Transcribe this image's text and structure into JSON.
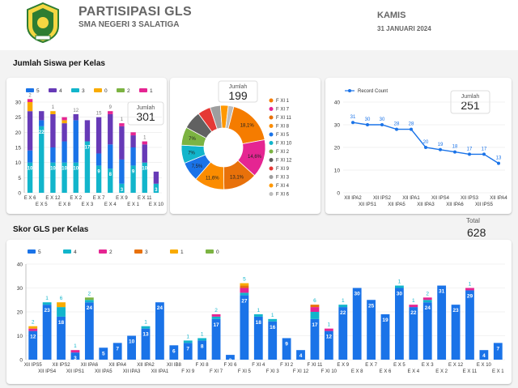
{
  "header": {
    "title": "PARTISIPASI GLS",
    "subtitle": "SMA NEGERI 3 SALATIGA",
    "day": "KAMIS",
    "date": "31 JANUARI 2024"
  },
  "colors": {
    "s5": "#1a73e8",
    "s4": "#12b5cb",
    "s3": "#e8710a",
    "s2": "#e52592",
    "s1": "#f9ab00",
    "s0": "#7cb342",
    "pie_orange": "#f57c00"
  },
  "sections": {
    "jumlah_siswa": "Jumlah Siswa per Kelas",
    "skor_gls": "Skor GLS per Kelas"
  },
  "scorecards": {
    "total_label": "Total",
    "total_value": "628"
  },
  "chart_data": [
    {
      "type": "bar",
      "stacked": true,
      "legend": [
        "5",
        "4",
        "3",
        "0",
        "2",
        "1"
      ],
      "categories": [
        "E X 6",
        "E X 5",
        "E X 12",
        "E X 8",
        "E X 2",
        "E X 3",
        "E X 7",
        "E X 4",
        "E X 9",
        "E X 1",
        "E X 11",
        "E X 10"
      ],
      "x_tick_labels": [
        "E X 6",
        "E X 5",
        "E X 12",
        "E X 8",
        "E X 2",
        "E X 3",
        "E X 7",
        "E X 4",
        "E X 9",
        "E X 1",
        "E X 11",
        "E X 10"
      ],
      "series": [
        {
          "name": "4",
          "color": "#12b5cb",
          "values": [
            10,
            22,
            10,
            10,
            10,
            17,
            9,
            8,
            3,
            9,
            10,
            3
          ]
        },
        {
          "name": "3",
          "color": "#1a73e8",
          "values": [
            4,
            2,
            5,
            7,
            14,
            0,
            4,
            8,
            8,
            6,
            0,
            0
          ]
        },
        {
          "name": "5",
          "color": "#673ab7",
          "values": [
            13,
            3,
            11,
            6,
            2,
            7,
            12,
            10,
            11,
            4,
            6,
            4
          ]
        },
        {
          "name": "0",
          "color": "#f9ab00",
          "values": [
            3,
            0,
            1,
            1,
            0,
            0,
            0,
            0,
            0,
            0,
            0,
            0
          ]
        },
        {
          "name": "2",
          "color": "#e52592",
          "values": [
            1,
            0,
            0,
            1,
            0,
            0,
            0,
            1,
            1,
            1,
            1,
            0
          ]
        },
        {
          "name": "1",
          "color": "#7cb342",
          "values": [
            0,
            0,
            0,
            0,
            0,
            0,
            0,
            0,
            0,
            0,
            0,
            0
          ]
        }
      ],
      "data_labels": [
        {
          "category": "E X 6",
          "series": "4",
          "text": "10"
        },
        {
          "category": "E X 6",
          "series": "3",
          "text": "4"
        },
        {
          "category": "E X 6",
          "series": "5",
          "text": "13"
        },
        {
          "category": "E X 6",
          "series": "0",
          "text": "3"
        },
        {
          "category": "E X 6",
          "series": "2",
          "text": "1"
        },
        {
          "category": "E X 6",
          "series": "top",
          "text": "2"
        },
        {
          "category": "E X 5",
          "series": "4",
          "text": "22"
        },
        {
          "category": "E X 12",
          "series": "4",
          "text": "10"
        },
        {
          "category": "E X 12",
          "series": "5",
          "text": "11"
        },
        {
          "category": "E X 12",
          "series": "top",
          "text": "1"
        },
        {
          "category": "E X 8",
          "series": "4",
          "text": "10"
        },
        {
          "category": "E X 2",
          "series": "4",
          "text": "10"
        },
        {
          "category": "E X 2",
          "series": "3",
          "text": "14"
        },
        {
          "category": "E X 2",
          "series": "top",
          "text": "12"
        },
        {
          "category": "E X 3",
          "series": "4",
          "text": "17"
        },
        {
          "category": "E X 7",
          "series": "4",
          "text": "9"
        },
        {
          "category": "E X 7",
          "series": "top",
          "text": "15"
        },
        {
          "category": "E X 4",
          "series": "4",
          "text": "8"
        },
        {
          "category": "E X 4",
          "series": "top",
          "text": "9"
        },
        {
          "category": "E X 9",
          "series": "4",
          "text": "3"
        },
        {
          "category": "E X 9",
          "series": "top",
          "text": "1"
        },
        {
          "category": "E X 1",
          "series": "4",
          "text": "9"
        },
        {
          "category": "E X 11",
          "series": "4",
          "text": "10"
        },
        {
          "category": "E X 11",
          "series": "top",
          "text": "1"
        },
        {
          "category": "E X 10",
          "series": "4",
          "text": "3"
        }
      ],
      "ylim": [
        0,
        30
      ],
      "yticks": [
        0,
        5,
        10,
        15,
        20,
        25,
        30
      ],
      "grid": true,
      "legend_position": "top",
      "scorecard": {
        "label": "Jumlah",
        "value": "301"
      }
    },
    {
      "type": "pie",
      "donut": true,
      "scorecard": {
        "label": "Jumlah",
        "value": "199"
      },
      "legend_position": "right",
      "slices": [
        {
          "label": "F XI 1",
          "value": 18.1,
          "color": "#f57c00",
          "text": "18,1%"
        },
        {
          "label": "F XI 7",
          "value": 14.6,
          "color": "#e52592",
          "text": "14,6%"
        },
        {
          "label": "F XI 11",
          "value": 13.1,
          "color": "#e8710a",
          "text": "13,1%"
        },
        {
          "label": "F XI 8",
          "value": 11.6,
          "color": "#fb8c00",
          "text": "11,6%"
        },
        {
          "label": "F XI 5",
          "value": 7.5,
          "color": "#1a73e8",
          "text": "7,5%"
        },
        {
          "label": "F XI 10",
          "value": 7,
          "color": "#12b5cb",
          "text": "7%"
        },
        {
          "label": "F XI 2",
          "value": 7,
          "color": "#7cb342",
          "text": "7%"
        },
        {
          "label": "F XI 12",
          "value": 7,
          "color": "#616161",
          "text": ""
        },
        {
          "label": "F XI 9",
          "value": 5,
          "color": "#e53935",
          "text": ""
        },
        {
          "label": "F XI 3",
          "value": 4,
          "color": "#9e9e9e",
          "text": ""
        },
        {
          "label": "F XI 4",
          "value": 3,
          "color": "#ff9800",
          "text": ""
        },
        {
          "label": "F XI 6",
          "value": 2.1,
          "color": "#bdbdbd",
          "text": ""
        }
      ],
      "legend": [
        "F XI 1",
        "F XI 7",
        "F XI 11",
        "F XI 8",
        "F XI 5",
        "F XI 10",
        "F XI 2",
        "F XI 12",
        "F XI 9",
        "F XI 3",
        "F XI 4",
        "F XI 6"
      ]
    },
    {
      "type": "line",
      "legend": [
        "Record Count"
      ],
      "legend_position": "top",
      "scorecard": {
        "label": "Jumlah",
        "value": "251"
      },
      "categories": [
        "XII IPA2",
        "XII IPS1",
        "XII IPS2",
        "XII IPA5",
        "XII IPA1",
        "XII IPA3",
        "XII IPS4",
        "XII IPA6",
        "XII IPS3",
        "XII IPS5",
        "XII IPA4"
      ],
      "x_tick_labels": [
        "XII IPA2",
        "XII IPS1",
        "XII IPS2",
        "XII IPA5",
        "XII IPA1",
        "XII IPA3",
        "XII IPS4",
        "XII IPA6",
        "XII IPS3",
        "XII IPS5",
        "XII IPA4"
      ],
      "values": [
        31,
        30,
        30,
        28,
        28,
        20,
        19,
        18,
        17,
        17,
        13
      ],
      "ylim": [
        0,
        40
      ],
      "yticks": [
        0,
        10,
        20,
        30,
        40
      ],
      "grid": true
    },
    {
      "type": "bar",
      "stacked": true,
      "legend": [
        "5",
        "4",
        "2",
        "3",
        "1",
        "0"
      ],
      "legend_position": "top",
      "categories": [
        "XII IPS5",
        "XII IPS4",
        "XII IPS2",
        "XII IPS1",
        "XII IPA6",
        "XII IPA5",
        "XII IPA4",
        "XII IPA3",
        "XII IPA2",
        "XII IPA1",
        "XII IB8",
        "F XI 9",
        "F XI 8",
        "F XI 7",
        "F XI 6",
        "F XI 5",
        "F XI 4",
        "F XI 3",
        "F XI 2",
        "F XI 12",
        "F XI 11",
        "F XI 10",
        "E X 9",
        "E X 8",
        "E X 7",
        "E X 6",
        "E X 5",
        "E X 4",
        "E X 3",
        "E X 2",
        "E X 12",
        "E X 11",
        "E X 10",
        "E X 1"
      ],
      "x_tick_labels": [
        "XII IPS5",
        "XII IPS4",
        "XII IPS2",
        "XII IPS1",
        "XII IPA6",
        "XII IPA5",
        "XII IPA4",
        "XII IPA3",
        "XII IPA2",
        "XII IPA1",
        "XII IB8",
        "F XI 9",
        "F XI 8",
        "F XI 7",
        "F XI 6",
        "F XI 5",
        "F XI 4",
        "F XI 3",
        "F XI 2",
        "F XI 12",
        "F XI 11",
        "F XI 10",
        "E X 9",
        "E X 8",
        "E X 7",
        "E X 6",
        "E X 5",
        "E X 4",
        "E X 3",
        "E X 2",
        "E X 12",
        "E X 11",
        "E X 10",
        "E X 1"
      ],
      "series": [
        {
          "name": "5",
          "color": "#1a73e8",
          "values": [
            12,
            23,
            18,
            3,
            24,
            5,
            7,
            10,
            13,
            24,
            6,
            7,
            8,
            17,
            2,
            27,
            18,
            16,
            9,
            4,
            17,
            12,
            22,
            30,
            25,
            19,
            30,
            22,
            24,
            31,
            23,
            29,
            4,
            7
          ]
        },
        {
          "name": "4",
          "color": "#12b5cb",
          "values": [
            0,
            1,
            4,
            0,
            1,
            0,
            0,
            0,
            1,
            0,
            0,
            1,
            1,
            1,
            0,
            1,
            1,
            1,
            0,
            0,
            3,
            0,
            1,
            0,
            0,
            0,
            1,
            0,
            1,
            0,
            0,
            0,
            0,
            0
          ]
        },
        {
          "name": "2",
          "color": "#e52592",
          "values": [
            1,
            0,
            0,
            1,
            0,
            0,
            0,
            0,
            0,
            0,
            0,
            0,
            0,
            1,
            0,
            2,
            0,
            0,
            0,
            0,
            2,
            1,
            0,
            0,
            0,
            0,
            0,
            1,
            1,
            0,
            0,
            1,
            0,
            0
          ]
        },
        {
          "name": "3",
          "color": "#e8710a",
          "values": [
            0,
            0,
            0,
            0,
            0,
            0,
            0,
            0,
            0,
            0,
            0,
            0,
            0,
            0,
            0,
            1,
            0,
            0,
            0,
            0,
            1,
            0,
            0,
            0,
            0,
            0,
            0,
            0,
            0,
            0,
            0,
            0,
            0,
            0
          ]
        },
        {
          "name": "1",
          "color": "#f9ab00",
          "values": [
            1,
            0,
            2,
            0,
            0,
            0,
            0,
            0,
            0,
            0,
            0,
            0,
            0,
            0,
            0,
            1,
            0,
            0,
            0,
            0,
            0,
            0,
            0,
            0,
            0,
            0,
            0,
            0,
            0,
            0,
            0,
            0,
            0,
            0
          ]
        },
        {
          "name": "0",
          "color": "#7cb342",
          "values": [
            0,
            0,
            0,
            0,
            1,
            0,
            0,
            0,
            0,
            0,
            0,
            0,
            0,
            0,
            0,
            0,
            0,
            0,
            0,
            0,
            0,
            0,
            0,
            0,
            0,
            0,
            0,
            0,
            0,
            0,
            0,
            0,
            0,
            0
          ]
        }
      ],
      "ylim": [
        0,
        40
      ],
      "yticks": [
        0,
        10,
        20,
        30,
        40
      ],
      "grid": true
    }
  ]
}
